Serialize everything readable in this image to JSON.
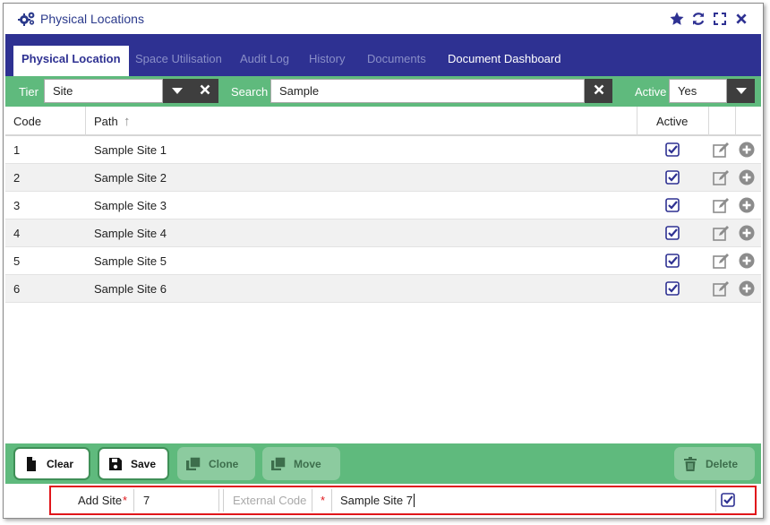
{
  "window": {
    "title": "Physical Locations",
    "title_icon": "gears-icon",
    "actions": [
      "star-icon",
      "refresh-icon",
      "expand-icon",
      "close-icon"
    ]
  },
  "tabs": [
    {
      "label": "Physical Location",
      "state": "active"
    },
    {
      "label": "Space Utilisation",
      "state": "muted"
    },
    {
      "label": "Audit Log",
      "state": "muted"
    },
    {
      "label": "History",
      "state": "muted"
    },
    {
      "label": "Documents",
      "state": "muted"
    },
    {
      "label": "Document Dashboard",
      "state": "normal"
    }
  ],
  "filters": {
    "tier_label": "Tier",
    "tier_value": "Site",
    "search_label": "Search",
    "search_value": "Sample",
    "active_label": "Active",
    "active_value": "Yes"
  },
  "table": {
    "columns": {
      "code": "Code",
      "path": "Path",
      "active": "Active"
    },
    "sort_indicator": "↑",
    "rows": [
      {
        "code": "1",
        "path": "Sample Site 1",
        "active": true
      },
      {
        "code": "2",
        "path": "Sample Site 2",
        "active": true
      },
      {
        "code": "3",
        "path": "Sample Site 3",
        "active": true
      },
      {
        "code": "4",
        "path": "Sample Site 4",
        "active": true
      },
      {
        "code": "5",
        "path": "Sample Site 5",
        "active": true
      },
      {
        "code": "6",
        "path": "Sample Site 6",
        "active": true
      }
    ]
  },
  "actions": {
    "clear": "Clear",
    "save": "Save",
    "clone": "Clone",
    "move": "Move",
    "delete": "Delete"
  },
  "add_row": {
    "label": "Add Site",
    "required_mark": "*",
    "code_value": "7",
    "external_code_placeholder": "External Code",
    "name_value": "Sample Site 7",
    "active": true
  },
  "colors": {
    "title": "#2b3a8c",
    "tab_bar": "#2e3192",
    "green_bar": "#5fba7d",
    "check": "#2e3192",
    "highlight_border": "#e0161b"
  }
}
